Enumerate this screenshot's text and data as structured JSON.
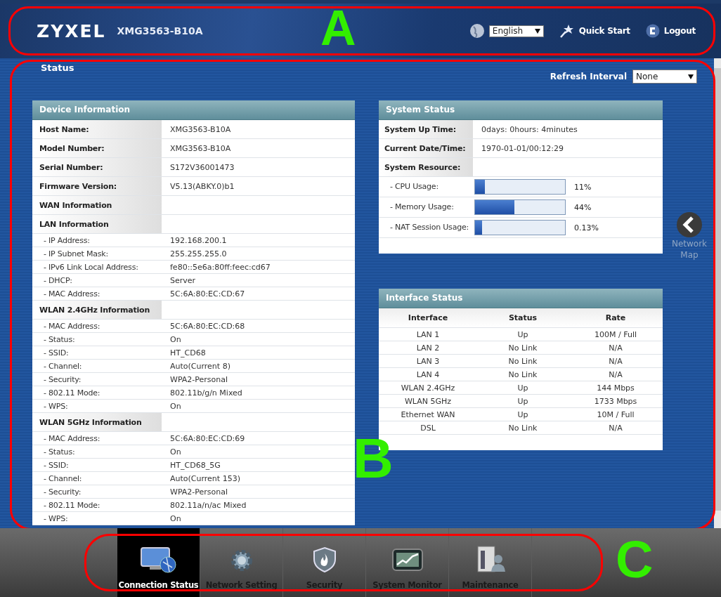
{
  "header": {
    "logo": "ZYXEL",
    "model": "XMG3563-B10A",
    "language": "English",
    "quick_start": "Quick Start",
    "logout": "Logout",
    "annotation": "A"
  },
  "main": {
    "title": "Status",
    "refresh_label": "Refresh Interval",
    "refresh_value": "None",
    "annotation": "B",
    "network_map": "Network Map"
  },
  "device_information": {
    "title": "Device Information",
    "rows": [
      {
        "kind": "field",
        "label": "Host Name:",
        "value": "XMG3563-B10A"
      },
      {
        "kind": "field",
        "label": "Model Number:",
        "value": "XMG3563-B10A"
      },
      {
        "kind": "field",
        "label": "Serial Number:",
        "value": "S172V36001473"
      },
      {
        "kind": "field",
        "label": "Firmware Version:",
        "value": "V5.13(ABKY.0)b1"
      },
      {
        "kind": "section",
        "label": "WAN Information"
      },
      {
        "kind": "section",
        "label": "LAN Information"
      },
      {
        "kind": "item",
        "label": "- IP Address:",
        "value": "192.168.200.1"
      },
      {
        "kind": "item",
        "label": "- IP Subnet Mask:",
        "value": "255.255.255.0"
      },
      {
        "kind": "item",
        "label": "- IPv6 Link Local Address:",
        "value": "fe80::5e6a:80ff:feec:cd67"
      },
      {
        "kind": "item",
        "label": "- DHCP:",
        "value": "Server"
      },
      {
        "kind": "item",
        "label": "- MAC Address:",
        "value": "5C:6A:80:EC:CD:67"
      },
      {
        "kind": "section",
        "label": "WLAN 2.4GHz Information"
      },
      {
        "kind": "item",
        "label": "- MAC Address:",
        "value": "5C:6A:80:EC:CD:68"
      },
      {
        "kind": "item",
        "label": "- Status:",
        "value": "On"
      },
      {
        "kind": "item",
        "label": "- SSID:",
        "value": "HT_CD68"
      },
      {
        "kind": "item",
        "label": "- Channel:",
        "value": "Auto(Current 8)"
      },
      {
        "kind": "item",
        "label": "- Security:",
        "value": "WPA2-Personal"
      },
      {
        "kind": "item",
        "label": "- 802.11 Mode:",
        "value": "802.11b/g/n Mixed"
      },
      {
        "kind": "item",
        "label": "- WPS:",
        "value": "On"
      },
      {
        "kind": "section",
        "label": "WLAN 5GHz Information"
      },
      {
        "kind": "item",
        "label": "- MAC Address:",
        "value": "5C:6A:80:EC:CD:69"
      },
      {
        "kind": "item",
        "label": "- Status:",
        "value": "On"
      },
      {
        "kind": "item",
        "label": "- SSID:",
        "value": "HT_CD68_5G"
      },
      {
        "kind": "item",
        "label": "- Channel:",
        "value": "Auto(Current 153)"
      },
      {
        "kind": "item",
        "label": "- Security:",
        "value": "WPA2-Personal"
      },
      {
        "kind": "item",
        "label": "- 802.11 Mode:",
        "value": "802.11a/n/ac Mixed"
      },
      {
        "kind": "item",
        "label": "- WPS:",
        "value": "On"
      }
    ]
  },
  "system_status": {
    "title": "System Status",
    "rows": [
      {
        "kind": "field",
        "label": "System Up Time:",
        "value": "0days: 0hours: 4minutes"
      },
      {
        "kind": "field",
        "label": "Current Date/Time:",
        "value": "1970-01-01/00:12:29"
      },
      {
        "kind": "section",
        "label": "System Resource:"
      },
      {
        "kind": "meter",
        "label": "- CPU Usage:",
        "level": 0.11,
        "value": "11%"
      },
      {
        "kind": "meter",
        "label": "- Memory Usage:",
        "level": 0.44,
        "value": "44%"
      },
      {
        "kind": "meter",
        "label": "- NAT Session Usage:",
        "level": 0.08,
        "value": "0.13%"
      }
    ]
  },
  "interface_status": {
    "title": "Interface Status",
    "columns": [
      "Interface",
      "Status",
      "Rate"
    ],
    "rows": [
      [
        "LAN 1",
        "Up",
        "100M / Full"
      ],
      [
        "LAN 2",
        "No Link",
        "N/A"
      ],
      [
        "LAN 3",
        "No Link",
        "N/A"
      ],
      [
        "LAN 4",
        "No Link",
        "N/A"
      ],
      [
        "WLAN 2.4GHz",
        "Up",
        "144 Mbps"
      ],
      [
        "WLAN 5GHz",
        "Up",
        "1733 Mbps"
      ],
      [
        "Ethernet WAN",
        "Up",
        "10M / Full"
      ],
      [
        "DSL",
        "No Link",
        "N/A"
      ]
    ]
  },
  "nav": {
    "annotation": "C",
    "items": [
      {
        "kind": "connection",
        "label": "Connection Status",
        "selected": true
      },
      {
        "kind": "network",
        "label": "Network Setting",
        "selected": false
      },
      {
        "kind": "security",
        "label": "Security",
        "selected": false
      },
      {
        "kind": "monitor",
        "label": "System Monitor",
        "selected": false
      },
      {
        "kind": "maintenance",
        "label": "Maintenance",
        "selected": false
      }
    ]
  }
}
